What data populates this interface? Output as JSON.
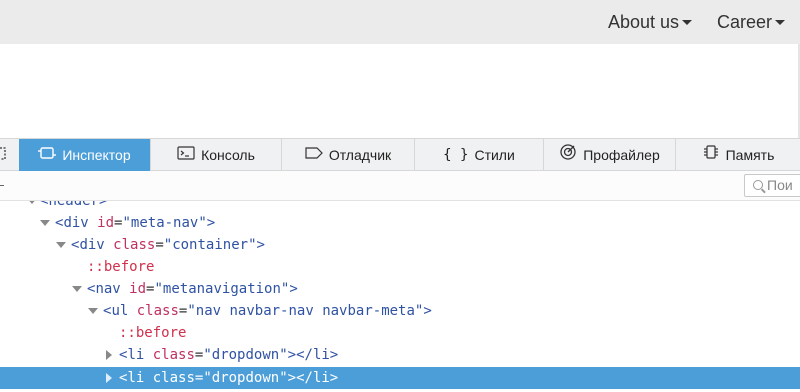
{
  "site_nav": {
    "about_label": "About us",
    "career_label": "Career"
  },
  "devtools": {
    "tabs": [
      {
        "label": "Инспектор",
        "icon": "inspector-icon",
        "active": true
      },
      {
        "label": "Консоль",
        "icon": "console-icon",
        "active": false
      },
      {
        "label": "Отладчик",
        "icon": "debugger-icon",
        "active": false
      },
      {
        "label": "Стили",
        "icon": "style-editor-icon",
        "active": false
      },
      {
        "label": "Профайлер",
        "icon": "profiler-icon",
        "active": false
      },
      {
        "label": "Память",
        "icon": "memory-icon",
        "active": false
      }
    ],
    "search_placeholder": "Пои"
  },
  "tree": {
    "r0": {
      "tag": "header"
    },
    "r1": {
      "tag": "div",
      "attr": "id",
      "val": "meta-nav"
    },
    "r2": {
      "tag": "div",
      "attr": "class",
      "val": "container"
    },
    "r3": {
      "pseudo": "::before"
    },
    "r4": {
      "tag": "nav",
      "attr": "id",
      "val": "metanavigation"
    },
    "r5": {
      "tag": "ul",
      "attr": "class",
      "val": "nav navbar-nav navbar-meta"
    },
    "r6": {
      "pseudo": "::before"
    },
    "r7": {
      "tag": "li",
      "attr": "class",
      "val": "dropdown"
    },
    "r8": {
      "tag": "li",
      "attr": "class",
      "val": "dropdown"
    }
  },
  "colors": {
    "accent": "#4c9ed9",
    "tag": "#2f52a3",
    "attr": "#c03060",
    "pseudo": "#d0304c"
  }
}
